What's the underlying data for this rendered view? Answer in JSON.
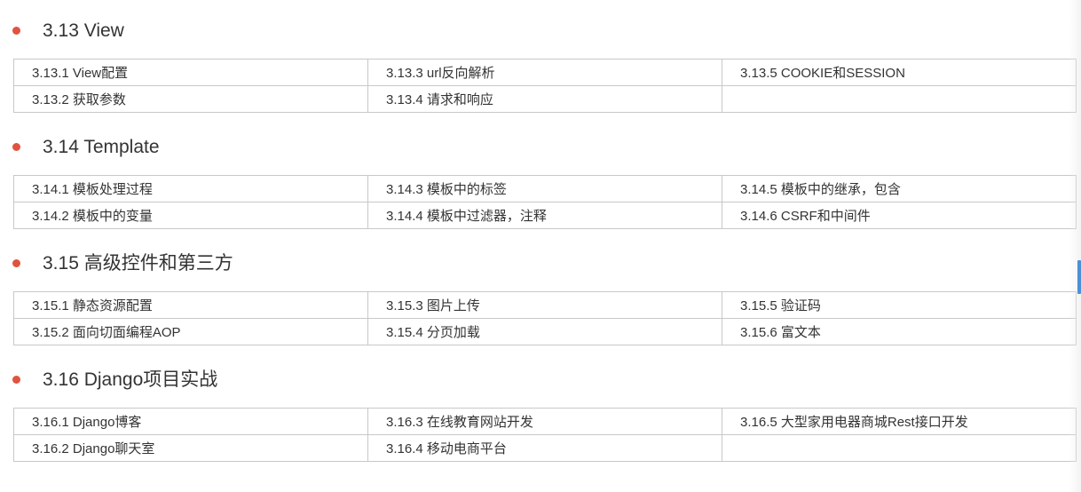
{
  "sections": [
    {
      "title": "3.13 View",
      "rows": [
        [
          "3.13.1 View配置",
          "3.13.3 url反向解析",
          "3.13.5 COOKIE和SESSION"
        ],
        [
          "3.13.2 获取参数",
          "3.13.4 请求和响应",
          ""
        ]
      ]
    },
    {
      "title": "3.14 Template",
      "rows": [
        [
          "3.14.1 模板处理过程",
          "3.14.3 模板中的标签",
          "3.14.5 模板中的继承，包含"
        ],
        [
          "3.14.2 模板中的变量",
          "3.14.4 模板中过滤器，注释",
          "3.14.6 CSRF和中间件"
        ]
      ]
    },
    {
      "title": "3.15 高级控件和第三方",
      "rows": [
        [
          "3.15.1 静态资源配置",
          "3.15.3 图片上传",
          "3.15.5 验证码"
        ],
        [
          "3.15.2 面向切面编程AOP",
          "3.15.4 分页加载",
          "3.15.6 富文本"
        ]
      ]
    },
    {
      "title": "3.16 Django项目实战",
      "rows": [
        [
          "3.16.1 Django博客",
          "3.16.3 在线教育网站开发",
          "3.16.5 大型家用电器商城Rest接口开发"
        ],
        [
          "3.16.2 Django聊天室",
          "3.16.4 移动电商平台",
          ""
        ]
      ]
    }
  ],
  "colors": {
    "bullet": "#e0533f",
    "border": "#c8c8c8",
    "text": "#333333",
    "scroll_indicator": "#4a90d9"
  }
}
